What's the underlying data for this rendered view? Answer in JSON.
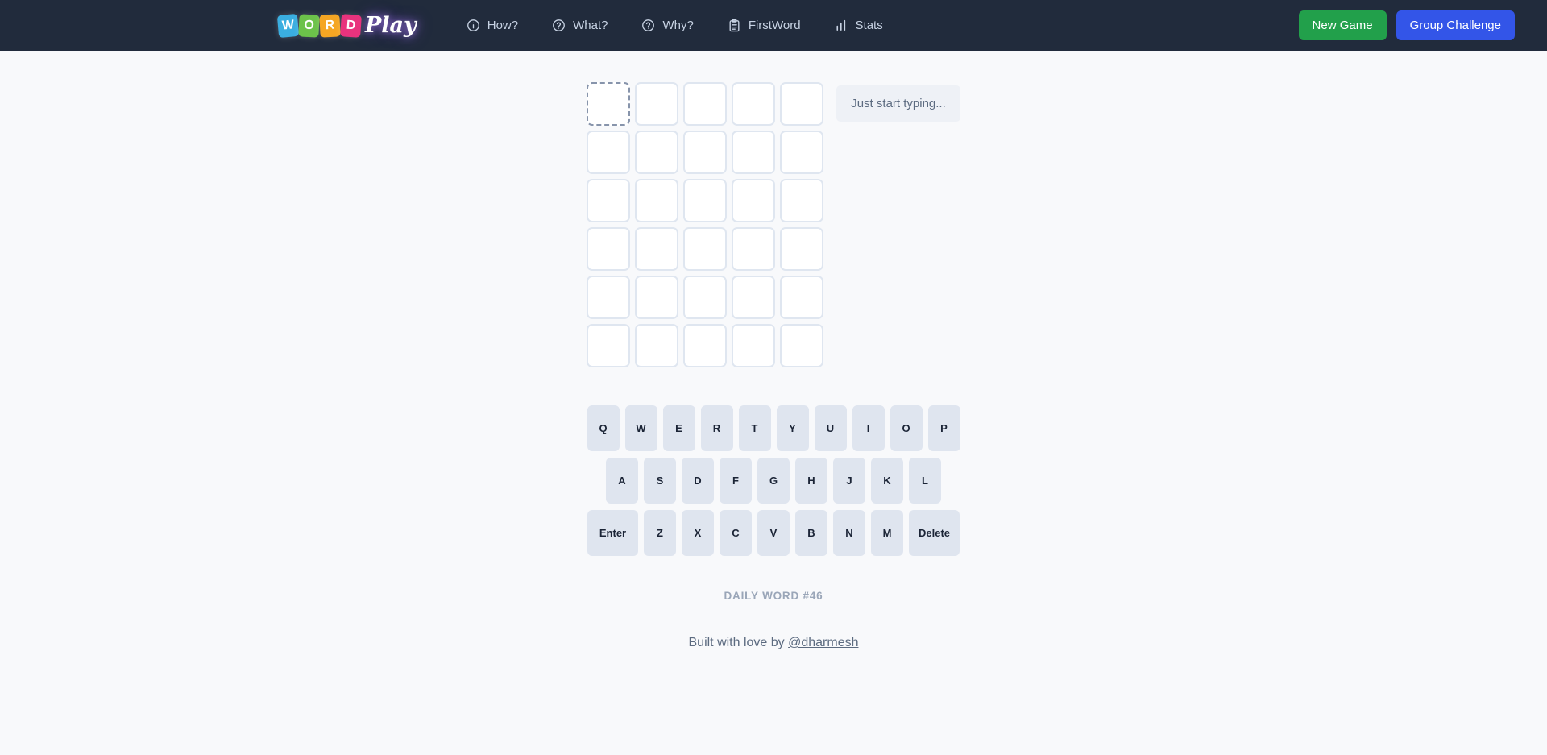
{
  "colors": {
    "header_bg": "#212b3c",
    "page_bg": "#f8f9fb",
    "new_game": "#22a04b",
    "group_challenge": "#3355e8",
    "key_bg": "#dfe5ef",
    "cell_border": "#dfe6f0",
    "active_cell_border": "#8794ab",
    "logo_w": "#3aaee0",
    "logo_o": "#6cc24a",
    "logo_r": "#f5a623",
    "logo_d": "#e8337d"
  },
  "header": {
    "logo": {
      "tiles": [
        {
          "letter": "W",
          "color": "#3aaee0"
        },
        {
          "letter": "O",
          "color": "#6cc24a"
        },
        {
          "letter": "R",
          "color": "#f5a623"
        },
        {
          "letter": "D",
          "color": "#e8337d"
        }
      ],
      "play_text": "Play"
    },
    "nav": [
      {
        "label": "How?",
        "icon": "info-circle-icon"
      },
      {
        "label": "What?",
        "icon": "question-circle-icon"
      },
      {
        "label": "Why?",
        "icon": "question-circle-icon"
      },
      {
        "label": "FirstWord",
        "icon": "clipboard-icon"
      },
      {
        "label": "Stats",
        "icon": "bar-chart-icon"
      }
    ],
    "actions": {
      "new_game": "New Game",
      "group_challenge": "Group Challenge"
    }
  },
  "board": {
    "rows": 6,
    "cols": 5,
    "active_cell": {
      "row": 0,
      "col": 0
    },
    "letters": [
      [
        "",
        "",
        "",
        "",
        ""
      ],
      [
        "",
        "",
        "",
        "",
        ""
      ],
      [
        "",
        "",
        "",
        "",
        ""
      ],
      [
        "",
        "",
        "",
        "",
        ""
      ],
      [
        "",
        "",
        "",
        "",
        ""
      ],
      [
        "",
        "",
        "",
        "",
        ""
      ]
    ]
  },
  "hint": {
    "text": "Just start typing..."
  },
  "keyboard": {
    "rows": [
      [
        {
          "label": "Q",
          "wide": false
        },
        {
          "label": "W",
          "wide": false
        },
        {
          "label": "E",
          "wide": false
        },
        {
          "label": "R",
          "wide": false
        },
        {
          "label": "T",
          "wide": false
        },
        {
          "label": "Y",
          "wide": false
        },
        {
          "label": "U",
          "wide": false
        },
        {
          "label": "I",
          "wide": false
        },
        {
          "label": "O",
          "wide": false
        },
        {
          "label": "P",
          "wide": false
        }
      ],
      [
        {
          "label": "A",
          "wide": false
        },
        {
          "label": "S",
          "wide": false
        },
        {
          "label": "D",
          "wide": false
        },
        {
          "label": "F",
          "wide": false
        },
        {
          "label": "G",
          "wide": false
        },
        {
          "label": "H",
          "wide": false
        },
        {
          "label": "J",
          "wide": false
        },
        {
          "label": "K",
          "wide": false
        },
        {
          "label": "L",
          "wide": false
        }
      ],
      [
        {
          "label": "Enter",
          "wide": true
        },
        {
          "label": "Z",
          "wide": false
        },
        {
          "label": "X",
          "wide": false
        },
        {
          "label": "C",
          "wide": false
        },
        {
          "label": "V",
          "wide": false
        },
        {
          "label": "B",
          "wide": false
        },
        {
          "label": "N",
          "wide": false
        },
        {
          "label": "M",
          "wide": false
        },
        {
          "label": "Delete",
          "wide": true
        }
      ]
    ]
  },
  "footer": {
    "daily_word": "DAILY WORD #46",
    "credit_prefix": "Built with love by ",
    "credit_link": "@dharmesh"
  }
}
